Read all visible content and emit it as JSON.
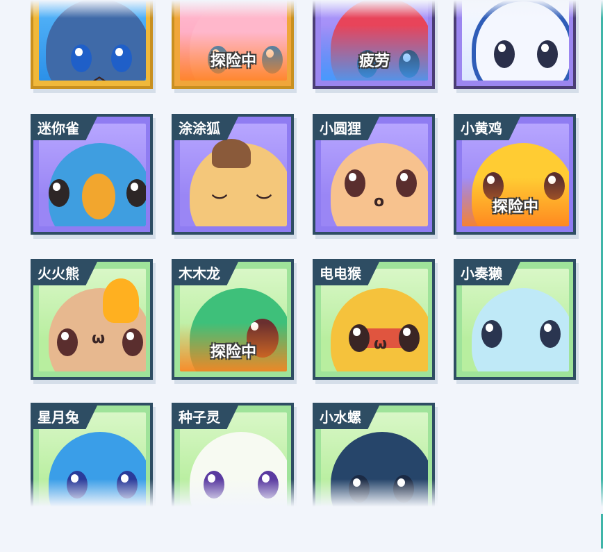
{
  "pets_row_top": [
    {
      "name": "",
      "status": ""
    },
    {
      "name": "",
      "status": "探险中"
    },
    {
      "name": "",
      "status": "疲劳"
    },
    {
      "name": "",
      "status": ""
    }
  ],
  "pets": [
    {
      "name": "迷你雀",
      "status": ""
    },
    {
      "name": "涂涂狐",
      "status": ""
    },
    {
      "name": "小圆狸",
      "status": ""
    },
    {
      "name": "小黄鸡",
      "status": "探险中"
    },
    {
      "name": "火火熊",
      "status": ""
    },
    {
      "name": "木木龙",
      "status": "探险中"
    },
    {
      "name": "电电猴",
      "status": ""
    },
    {
      "name": "小奏獭",
      "status": ""
    },
    {
      "name": "星月兔",
      "status": ""
    },
    {
      "name": "种子灵",
      "status": ""
    },
    {
      "name": "小水螺",
      "status": ""
    }
  ],
  "colors": {
    "page_bg": "#f2f5fb",
    "card_border": "#2e4d63",
    "card_purple": "#8f7cf2",
    "card_green": "#9fe39a",
    "selected_border": "#c9901f"
  }
}
